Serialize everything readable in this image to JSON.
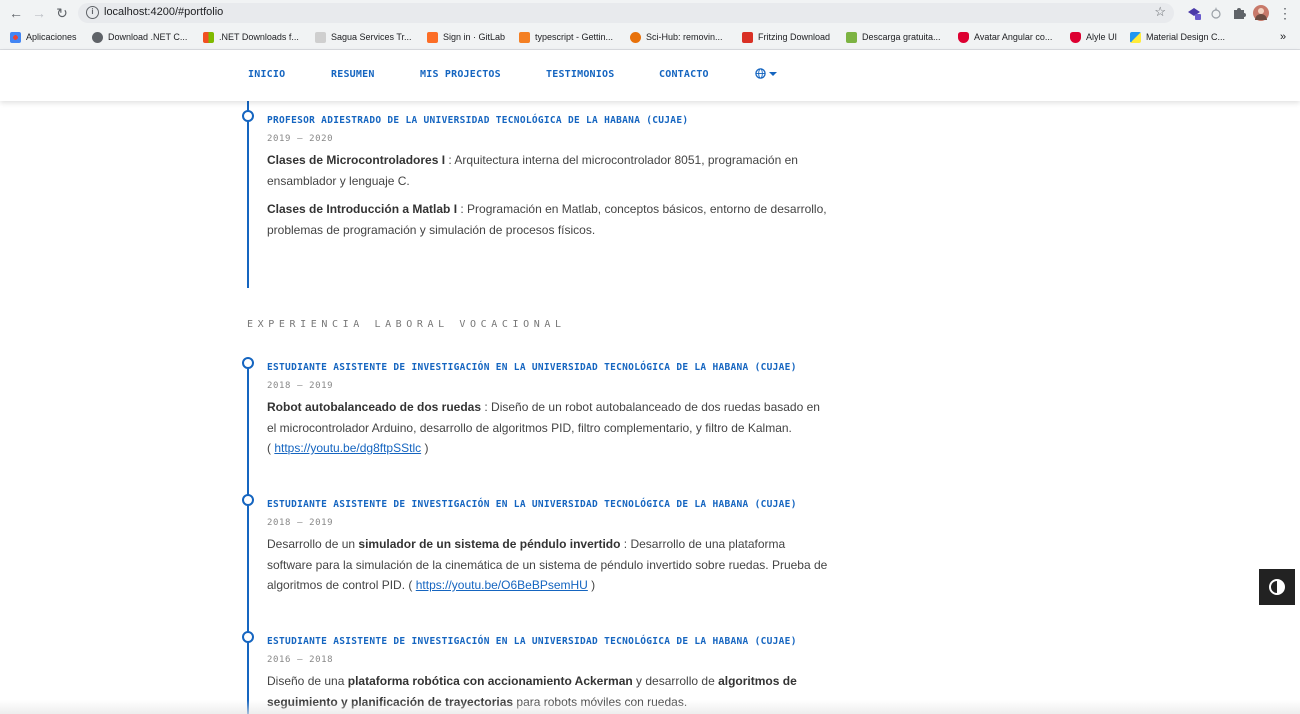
{
  "browser": {
    "url": "localhost:4200/#portfolio",
    "bookmarks": [
      {
        "label": "Aplicaciones",
        "color": "#ea4335"
      },
      {
        "label": "Download .NET C...",
        "color": "#5f6368"
      },
      {
        "label": ".NET Downloads f...",
        "color": "#00a4ef"
      },
      {
        "label": "Sagua Services Tr...",
        "color": "#bbbbbb"
      },
      {
        "label": "Sign in · GitLab",
        "color": "#fc6d26"
      },
      {
        "label": "typescript - Gettin...",
        "color": "#f48024"
      },
      {
        "label": "Sci-Hub: removin...",
        "color": "#e8710a"
      },
      {
        "label": "Fritzing Download",
        "color": "#d93025"
      },
      {
        "label": "Descarga gratuita...",
        "color": "#7cb342"
      },
      {
        "label": "Avatar Angular co...",
        "color": "#dd0031"
      },
      {
        "label": "Alyle UI",
        "color": "#dd0031"
      },
      {
        "label": "Material Design C...",
        "color": "#2196f3"
      }
    ],
    "more": "»"
  },
  "nav": {
    "items": [
      "INICIO",
      "RESUMEN",
      "MIS PROJECTOS",
      "TESTIMONIOS",
      "CONTACTO"
    ],
    "lang_icon": "globe-icon"
  },
  "teaching": {
    "title": "PROFESOR ADIESTRADO DE LA UNIVERSIDAD TECNOLÓGICA DE LA HABANA (CUJAE)",
    "date": "2019 — 2020",
    "p1_bold": "Clases de Microcontroladores I",
    "p1_text": " : Arquitectura interna del microcontrolador 8051, programación en ensamblador y lenguaje C.",
    "p2_bold": "Clases de Introducción a Matlab I",
    "p2_text": " : Programación en Matlab, conceptos básicos, entorno de desarrollo, problemas de programación y simulación de procesos físicos."
  },
  "section_title": "EXPERIENCIA LABORAL VOCACIONAL",
  "entries": [
    {
      "title": "ESTUDIANTE ASISTENTE DE INVESTIGACIÓN EN LA UNIVERSIDAD TECNOLÓGICA DE LA HABANA (CUJAE)",
      "date": "2018 — 2019",
      "bold": "Robot autobalanceado de dos ruedas",
      "text": " : Diseño de un robot autobalanceado de dos ruedas basado en el microcontrolador Arduino, desarrollo de algoritmos PID, filtro complementario, y filtro de Kalman.",
      "link_open": "( ",
      "link": "https://youtu.be/dg8ftpSStlc",
      "link_close": " )"
    },
    {
      "title": "ESTUDIANTE ASISTENTE DE INVESTIGACIÓN EN LA UNIVERSIDAD TECNOLÓGICA DE LA HABANA (CUJAE)",
      "date": "2018 — 2019",
      "pre": "Desarrollo de un ",
      "bold": "simulador de un sistema de péndulo invertido",
      "text": " : Desarrollo de una plataforma software para la simulación de la cinemática de un sistema de péndulo invertido sobre ruedas. Prueba de algoritmos de control PID. ",
      "link_open": "( ",
      "link": "https://youtu.be/O6BeBPsemHU",
      "link_close": " )"
    },
    {
      "title": "ESTUDIANTE ASISTENTE DE INVESTIGACIÓN EN LA UNIVERSIDAD TECNOLÓGICA DE LA HABANA (CUJAE)",
      "date": "2016 — 2018",
      "pre": "Diseño de una ",
      "bold": "plataforma robótica con accionamiento Ackerman",
      "mid": " y desarrollo de ",
      "bold2": "algoritmos de seguimiento y planificación de trayectorias",
      "text": " para robots móviles con ruedas."
    }
  ],
  "theme_toggle_icon": "contrast-icon"
}
